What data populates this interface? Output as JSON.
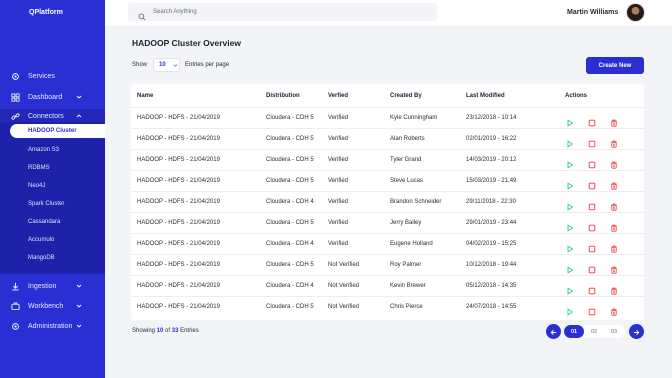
{
  "brand": "QPlatform",
  "search": {
    "placeholder": "Search Anything"
  },
  "user": {
    "name": "Martin Williams"
  },
  "sidebar": {
    "items": [
      {
        "label": "Services",
        "icon": "gear-icon"
      },
      {
        "label": "Dashboard",
        "icon": "dashboard-icon"
      },
      {
        "label": "Connectors",
        "icon": "link-icon"
      },
      {
        "label": "Ingestion",
        "icon": "ingestion-icon"
      },
      {
        "label": "Workbench",
        "icon": "workbench-icon"
      },
      {
        "label": "Administration",
        "icon": "admin-gear-icon"
      }
    ],
    "connectors": [
      "HADOOP Cluster",
      "Amazon S3",
      "RDBMS",
      "Neo4J",
      "Spark Cluster",
      "Cassandara",
      "Accumulo",
      "MangoDB"
    ]
  },
  "main": {
    "title": "HADOOP Cluster Overview",
    "show_label": "Show",
    "entries_value": "10",
    "per_page_label": "Entries per page",
    "create_label": "Create New"
  },
  "table": {
    "headers": [
      "Name",
      "Distribution",
      "Verfied",
      "Created By",
      "Last Modified",
      "Actions"
    ],
    "rows": [
      [
        "HADOOP - HDFS - 21/04/2019",
        "Cloudera - CDH 5",
        "Verified",
        "Kyle Cunningham",
        "23/12/2018 - 10:14"
      ],
      [
        "HADOOP - HDFS - 21/04/2019",
        "Cloudera - CDH 5",
        "Verified",
        "Alan Roberts",
        "02/01/2019 - 16:22"
      ],
      [
        "HADOOP - HDFS - 21/04/2019",
        "Cloudera - CDH 5",
        "Verified",
        "Tyler Grand",
        "14/03/2019 - 20:12"
      ],
      [
        "HADOOP - HDFS - 21/04/2019",
        "Cloudera - CDH 5",
        "Verified",
        "Steve Lucas",
        "15/03/2019 - 21:49"
      ],
      [
        "HADOOP - HDFS - 21/04/2019",
        "Cloudera - CDH 4",
        "Verified",
        "Brandon Schneider",
        "29/11/2018 - 22:30"
      ],
      [
        "HADOOP - HDFS - 21/04/2019",
        "Cloudera - CDH 5",
        "Verified",
        "Jerry Bailey",
        "29/01/2019 - 23:44"
      ],
      [
        "HADOOP - HDFS - 21/04/2019",
        "Cloudera - CDH 4",
        "Verified",
        "Eugene Holland",
        "04/02/2019 - 15:25"
      ],
      [
        "HADOOP - HDFS - 21/04/2019",
        "Cloudera - CDH 5",
        "Not Verified",
        "Roy Palmer",
        "10/12/2018 - 19:44"
      ],
      [
        "HADOOP - HDFS - 21/04/2019",
        "Cloudera - CDH 4",
        "Not Verified",
        "Kevin Brewer",
        "05/12/2018 - 14:35"
      ],
      [
        "HADOOP - HDFS - 21/04/2019",
        "Cloudera - CDH 5",
        "Not Verified",
        "Chris Pierce",
        "24/07/2018 - 14:55"
      ]
    ]
  },
  "footer": {
    "showing_prefix": "Showing",
    "showing_count": "10",
    "of_label": "of",
    "total_count": "33",
    "entries_label": "Entries",
    "pages": [
      "01",
      "02",
      "03"
    ]
  },
  "colors": {
    "accent": "#2a2fd4",
    "play": "#2fd17a",
    "stop": "#e8403f",
    "delete": "#e8403f"
  }
}
